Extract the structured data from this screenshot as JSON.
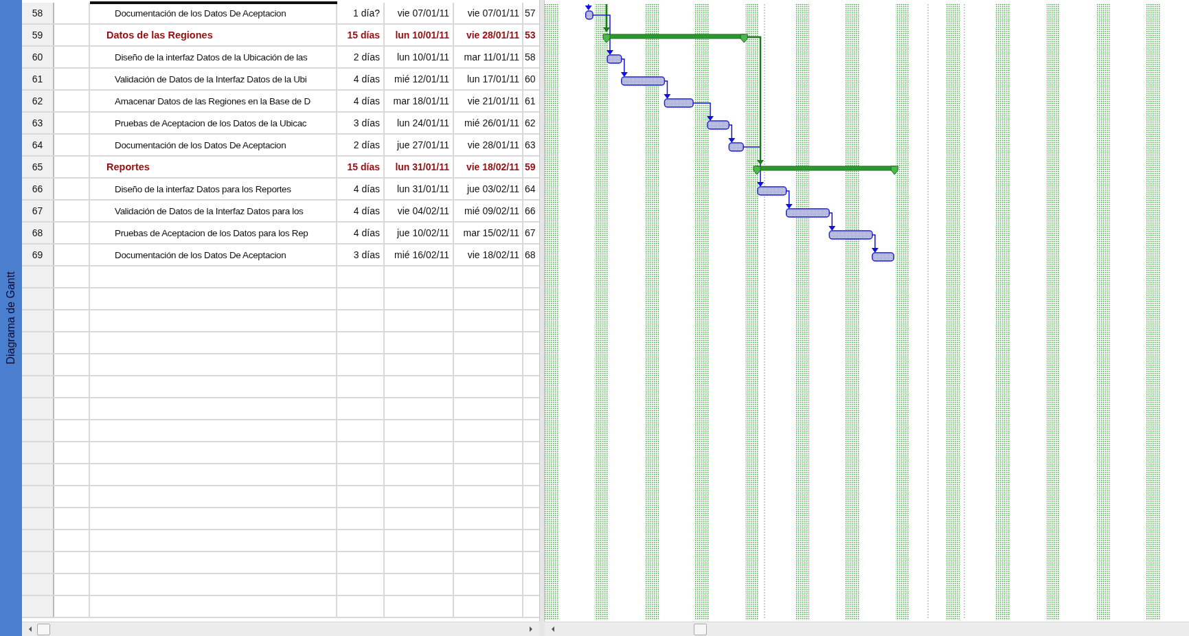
{
  "side_label": "Diagrama de Gantt",
  "rows": [
    {
      "id": "58",
      "kind": "task",
      "name": "Documentación de los Datos De Aceptacion",
      "duration": "1 día?",
      "start": "vie 07/01/11",
      "finish": "vie 07/01/11",
      "predecessors": "57"
    },
    {
      "id": "59",
      "kind": "summary",
      "name": "Datos de las Regiones",
      "duration": "15 días",
      "start": "lun 10/01/11",
      "finish": "vie 28/01/11",
      "predecessors": "53"
    },
    {
      "id": "60",
      "kind": "task",
      "name": "Diseño de la interfaz Datos de la Ubicación de las",
      "duration": "2 días",
      "start": "lun 10/01/11",
      "finish": "mar 11/01/11",
      "predecessors": "58"
    },
    {
      "id": "61",
      "kind": "task",
      "name": "Validación de Datos de la Interfaz Datos de la Ubi",
      "duration": "4 días",
      "start": "mié 12/01/11",
      "finish": "lun 17/01/11",
      "predecessors": "60"
    },
    {
      "id": "62",
      "kind": "task",
      "name": "Amacenar Datos de las Regiones en la Base de D",
      "duration": "4 días",
      "start": "mar 18/01/11",
      "finish": "vie 21/01/11",
      "predecessors": "61"
    },
    {
      "id": "63",
      "kind": "task",
      "name": "Pruebas de Aceptacion de los Datos de la Ubicac",
      "duration": "3 días",
      "start": "lun 24/01/11",
      "finish": "mié 26/01/11",
      "predecessors": "62"
    },
    {
      "id": "64",
      "kind": "task",
      "name": "Documentación de los Datos De Aceptacion",
      "duration": "2 días",
      "start": "jue 27/01/11",
      "finish": "vie 28/01/11",
      "predecessors": "63"
    },
    {
      "id": "65",
      "kind": "summary",
      "name": "Reportes",
      "duration": "15 días",
      "start": "lun 31/01/11",
      "finish": "vie 18/02/11",
      "predecessors": "59"
    },
    {
      "id": "66",
      "kind": "task",
      "name": "Diseño de la interfaz Datos para los Reportes",
      "duration": "4 días",
      "start": "lun 31/01/11",
      "finish": "jue 03/02/11",
      "predecessors": "64"
    },
    {
      "id": "67",
      "kind": "task",
      "name": "Validación de Datos de la Interfaz Datos para los",
      "duration": "4 días",
      "start": "vie 04/02/11",
      "finish": "mié 09/02/11",
      "predecessors": "66"
    },
    {
      "id": "68",
      "kind": "task",
      "name": "Pruebas de Aceptacion de los Datos para los Rep",
      "duration": "4 días",
      "start": "jue 10/02/11",
      "finish": "mar 15/02/11",
      "predecessors": "67"
    },
    {
      "id": "69",
      "kind": "task",
      "name": "Documentación de los Datos De Aceptacion",
      "duration": "3 días",
      "start": "mié 16/02/11",
      "finish": "vie 18/02/11",
      "predecessors": "68"
    }
  ]
}
